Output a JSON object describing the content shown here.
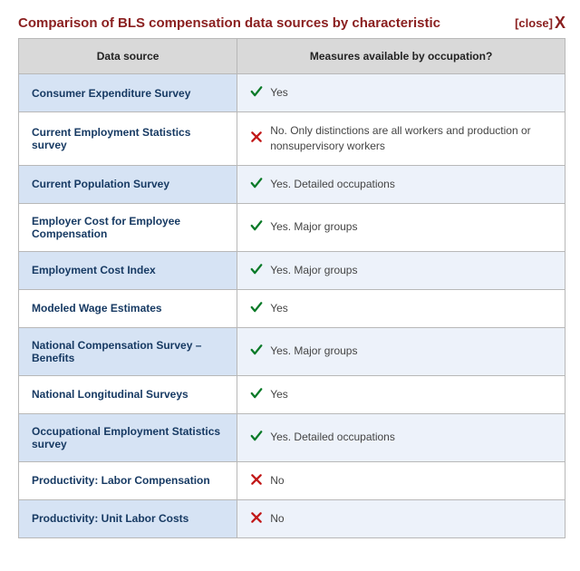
{
  "title": "Comparison of BLS compensation data sources by characteristic",
  "close_label": "[close]",
  "columns": {
    "source": "Data source",
    "measure": "Measures available by occupation?"
  },
  "rows": [
    {
      "source": "Consumer Expenditure Survey",
      "ok": true,
      "text": "Yes"
    },
    {
      "source": "Current Employment Statistics survey",
      "ok": false,
      "text": "No. Only distinctions are all workers and production or nonsupervisory workers"
    },
    {
      "source": "Current Population Survey",
      "ok": true,
      "text": "Yes. Detailed occupations"
    },
    {
      "source": "Employer Cost for Employee Compensation",
      "ok": true,
      "text": "Yes. Major groups"
    },
    {
      "source": "Employment Cost Index",
      "ok": true,
      "text": "Yes. Major groups"
    },
    {
      "source": "Modeled Wage Estimates",
      "ok": true,
      "text": "Yes"
    },
    {
      "source": "National Compensation Survey – Benefits",
      "ok": true,
      "text": "Yes. Major groups"
    },
    {
      "source": "National Longitudinal Surveys",
      "ok": true,
      "text": "Yes"
    },
    {
      "source": "Occupational Employment Statistics survey",
      "ok": true,
      "text": "Yes. Detailed occupations"
    },
    {
      "source": "Productivity: Labor Compensation",
      "ok": false,
      "text": "No"
    },
    {
      "source": "Productivity: Unit Labor Costs",
      "ok": false,
      "text": "No"
    }
  ]
}
